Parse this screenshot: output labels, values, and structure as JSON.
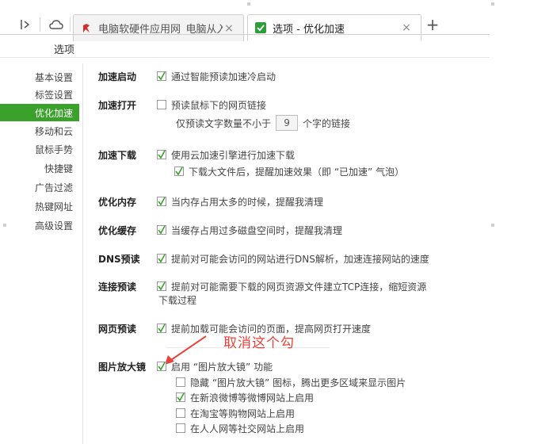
{
  "browser": {
    "tabs": [
      {
        "title": "电脑软硬件应用网_电脑从入门",
        "close": "×",
        "active": false
      },
      {
        "title": "选项 - 优化加速",
        "close": "×",
        "active": true
      }
    ],
    "new_tab": "+",
    "nav_back": "|>",
    "nav_cloud": "cloud-icon"
  },
  "page": {
    "title": "选项"
  },
  "sidebar": {
    "items": [
      {
        "label": "基本设置",
        "active": false
      },
      {
        "label": "标签设置",
        "active": false
      },
      {
        "label": "优化加速",
        "active": true
      },
      {
        "label": "移动和云",
        "active": false
      },
      {
        "label": "鼠标手势",
        "active": false
      },
      {
        "label": "快捷键",
        "active": false
      },
      {
        "label": "广告过滤",
        "active": false
      },
      {
        "label": "热键网址",
        "active": false
      },
      {
        "label": "高级设置",
        "active": false
      }
    ]
  },
  "settings": {
    "startup": {
      "label": "加速启动",
      "option": "通过智能预读加速冷启动",
      "checked": true
    },
    "open": {
      "label": "加速打开",
      "option": "预读鼠标下的网页链接",
      "checked": false,
      "sub_prefix": "仅预读文字数量不小于",
      "sub_value": "9",
      "sub_suffix": "个字的链接"
    },
    "download": {
      "label": "加速下载",
      "option": "使用云加速引擎进行加速下载",
      "checked": true,
      "sub_option": "下载大文件后，提醒加速效果（即 “已加速” 气泡）",
      "sub_checked": true
    },
    "memory": {
      "label": "优化内存",
      "option": "当内存占用太多的时候，提醒我清理",
      "checked": true
    },
    "cache": {
      "label": "优化缓存",
      "option": "当缓存占用过多磁盘空间时，提醒我清理",
      "checked": true
    },
    "dns": {
      "label": "DNS预读",
      "option": "提前对可能会访问的网站进行DNS解析，加速连接网站的速度",
      "checked": true
    },
    "connect": {
      "label": "连接预读",
      "option_line1": "提前对可能需要下载的网页资源文件建立TCP连接，缩短资源",
      "option_line2": "下载过程",
      "checked": true
    },
    "webpage": {
      "label": "网页预读",
      "option": "提前加载可能会访问的页面，提高网页打开速度",
      "checked": true
    },
    "magnifier": {
      "label": "图片放大镜",
      "option": "启用 “图片放大镜” 功能",
      "checked": true,
      "subs": [
        {
          "text": "隐藏 “图片放大镜” 图标，腾出更多区域来显示图片",
          "checked": false
        },
        {
          "text": "在新浪微博等微博网站上启用",
          "checked": true
        },
        {
          "text": "在淘宝等购物网站上启用",
          "checked": false
        },
        {
          "text": "在人人网等社交网站上启用",
          "checked": false
        }
      ]
    }
  },
  "annotation": {
    "text": "取消这个勾",
    "color": "#e8423a"
  },
  "colors": {
    "accent": "#3aa12b",
    "annotation": "#e8423a"
  }
}
